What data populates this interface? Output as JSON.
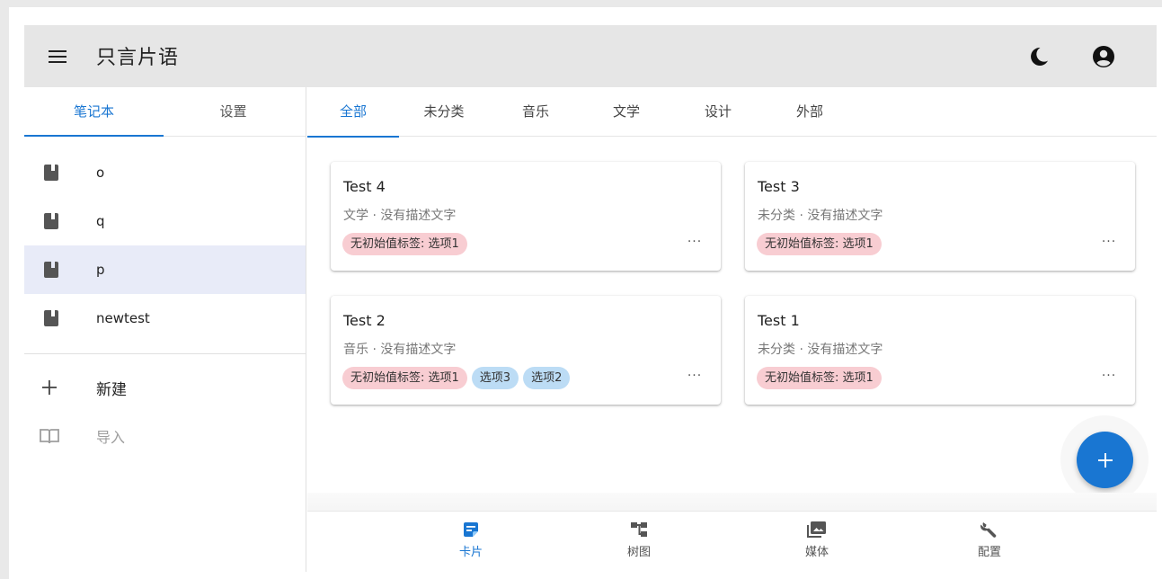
{
  "app": {
    "title": "只言片语"
  },
  "sidebar": {
    "tabs": [
      {
        "label": "笔记本",
        "active": true
      },
      {
        "label": "设置",
        "active": false
      }
    ],
    "notebooks": [
      {
        "label": "o",
        "selected": false
      },
      {
        "label": "q",
        "selected": false
      },
      {
        "label": "p",
        "selected": true
      },
      {
        "label": "newtest",
        "selected": false
      }
    ],
    "actions": [
      {
        "label": "新建",
        "icon": "plus-icon",
        "enabled": true
      },
      {
        "label": "导入",
        "icon": "open-book-icon",
        "enabled": false
      }
    ]
  },
  "categories": [
    {
      "label": "全部",
      "active": true
    },
    {
      "label": "未分类",
      "active": false
    },
    {
      "label": "音乐",
      "active": false
    },
    {
      "label": "文学",
      "active": false
    },
    {
      "label": "设计",
      "active": false
    },
    {
      "label": "外部",
      "active": false
    }
  ],
  "cards": [
    {
      "title": "Test 4",
      "subtitle": "文学 · 没有描述文字",
      "tags": [
        {
          "text": "无初始值标签: 选项1",
          "color": "#f8cdd2"
        }
      ],
      "more": "···"
    },
    {
      "title": "Test 3",
      "subtitle": "未分类 · 没有描述文字",
      "tags": [
        {
          "text": "无初始值标签: 选项1",
          "color": "#f8cdd2"
        }
      ],
      "more": "···"
    },
    {
      "title": "Test 2",
      "subtitle": "音乐 · 没有描述文字",
      "tags": [
        {
          "text": "无初始值标签: 选项1",
          "color": "#f8cdd2"
        },
        {
          "text": "选项3",
          "color": "#bcdcf5"
        },
        {
          "text": "选项2",
          "color": "#bcdcf5"
        }
      ],
      "more": "···"
    },
    {
      "title": "Test 1",
      "subtitle": "未分类 · 没有描述文字",
      "tags": [
        {
          "text": "无初始值标签: 选项1",
          "color": "#f8cdd2"
        }
      ],
      "more": "···"
    }
  ],
  "bottom_nav": [
    {
      "label": "卡片",
      "icon": "note-card-icon",
      "active": true
    },
    {
      "label": "树图",
      "icon": "tree-diagram-icon",
      "active": false
    },
    {
      "label": "媒体",
      "icon": "media-gallery-icon",
      "active": false
    },
    {
      "label": "配置",
      "icon": "wrench-icon",
      "active": false
    }
  ],
  "colors": {
    "accent": "#1976d2",
    "topbar": "#e6e6e6",
    "selected_row": "#e8ebf8",
    "tag_red": "#f8cdd2",
    "tag_blue": "#bcdcf5"
  }
}
